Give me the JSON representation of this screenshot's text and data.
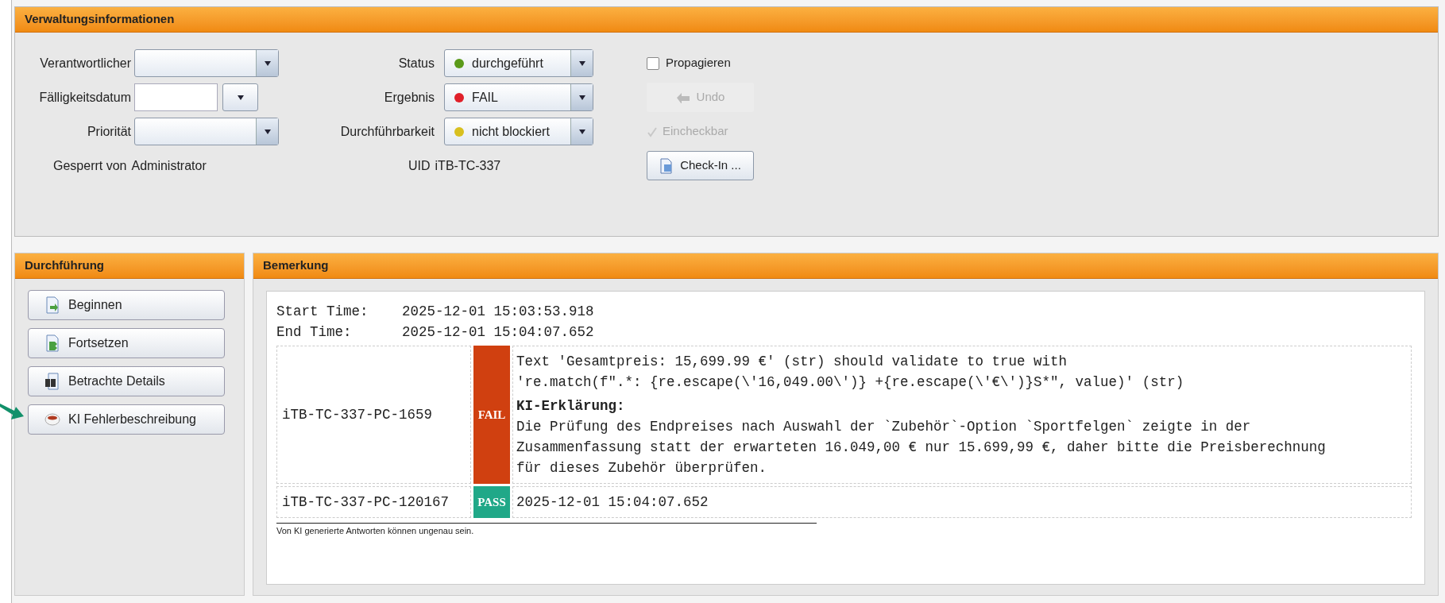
{
  "admin": {
    "title": "Verwaltungsinformationen",
    "left_fields": [
      {
        "label": "Verantwortlicher",
        "kind": "combo"
      },
      {
        "label": "Fälligkeitsdatum",
        "kind": "date"
      },
      {
        "label": "Priorität",
        "kind": "combo"
      }
    ],
    "locked_by": {
      "label": "Gesperrt von",
      "value": "Administrator"
    },
    "middle_fields": [
      {
        "label": "Status",
        "value": "durchgeführt",
        "color": "#5a9a1a"
      },
      {
        "label": "Ergebnis",
        "value": "FAIL",
        "color": "#e0202a"
      },
      {
        "label": "Durchführbarkeit",
        "value": "nicht blockiert",
        "color": "#d8c020"
      }
    ],
    "uid": {
      "label": "UID",
      "value": "iTB-TC-337"
    },
    "propagate": {
      "label": "Propagieren",
      "checked": false
    },
    "undo": {
      "label": "Undo",
      "disabled": true
    },
    "checkin_ready": {
      "label": "Eincheckbar",
      "checked": true,
      "disabled": true
    },
    "checkin": {
      "label": "Check-In ..."
    }
  },
  "execution": {
    "title": "Durchführung",
    "buttons": [
      {
        "label": "Beginnen",
        "kind": "start"
      },
      {
        "label": "Fortsetzen",
        "kind": "continue"
      },
      {
        "label": "Betrachte Details",
        "kind": "details"
      },
      {
        "label": "KI Fehlerbeschreibung",
        "kind": "ai"
      }
    ]
  },
  "remark": {
    "title": "Bemerkung",
    "times": [
      {
        "label": "Start Time:",
        "value": "2025-12-01 15:03:53.918"
      },
      {
        "label": "End Time:",
        "value": "2025-12-01 15:04:07.652"
      }
    ],
    "results": [
      {
        "id": "iTB-TC-337-PC-1659",
        "status": "FAIL",
        "kind": "fail",
        "message_lines": [
          "Text 'Gesamtpreis: 15,699.99 €' (str) should validate to true with",
          "'re.match(f\".*: {re.escape(\\'16,049.00\\')} +{re.escape(\\'€\\')}S*\", value)' (str)"
        ],
        "explanation_title": "KI-Erklärung:",
        "explanation_lines": [
          "Die Prüfung des Endpreises nach Auswahl der `Zubehör`-Option `Sportfelgen` zeigte in der",
          "Zusammenfassung statt der erwarteten 16.049,00 € nur 15.699,99 €, daher bitte die Preisberechnung",
          "für dieses Zubehör überprüfen."
        ]
      },
      {
        "id": "iTB-TC-337-PC-120167",
        "status": "PASS",
        "kind": "pass",
        "message_lines": [
          "2025-12-01 15:04:07.652"
        ]
      }
    ],
    "disclaimer": "Von KI generierte Antworten können ungenau sein."
  }
}
